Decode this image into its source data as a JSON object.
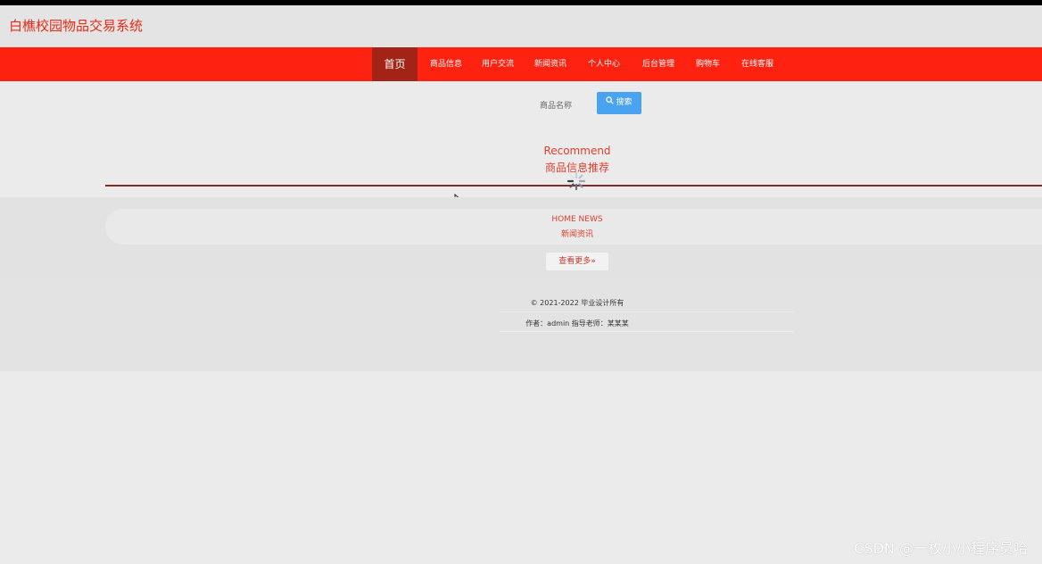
{
  "header": {
    "site_title": "白樵校园物品交易系统"
  },
  "nav": {
    "items": [
      {
        "label": "首页",
        "active": true
      },
      {
        "label": "商品信息"
      },
      {
        "label": "用户交流"
      },
      {
        "label": "新闻资讯"
      },
      {
        "label": "个人中心"
      },
      {
        "label": "后台管理"
      },
      {
        "label": "购物车"
      },
      {
        "label": "在线客服"
      }
    ]
  },
  "search": {
    "label": "商品名称",
    "button_label": "搜索",
    "button_icon": "search-icon"
  },
  "recommend": {
    "title_en": "Recommend",
    "title_cn": "商品信息推荐"
  },
  "news": {
    "title_en": "HOME NEWS",
    "title_cn": "新闻资讯",
    "more_label": "查看更多»"
  },
  "footer": {
    "copyright": "© 2021-2022 毕业设计所有",
    "author": "作者：admin 指导老师：某某某"
  },
  "watermark": "CSDN @一枚小小程序员哈",
  "colors": {
    "nav_bg": "#ff2211",
    "nav_active": "#a32316",
    "accent_text": "#e23d2d",
    "search_button": "#4aa3f0"
  }
}
